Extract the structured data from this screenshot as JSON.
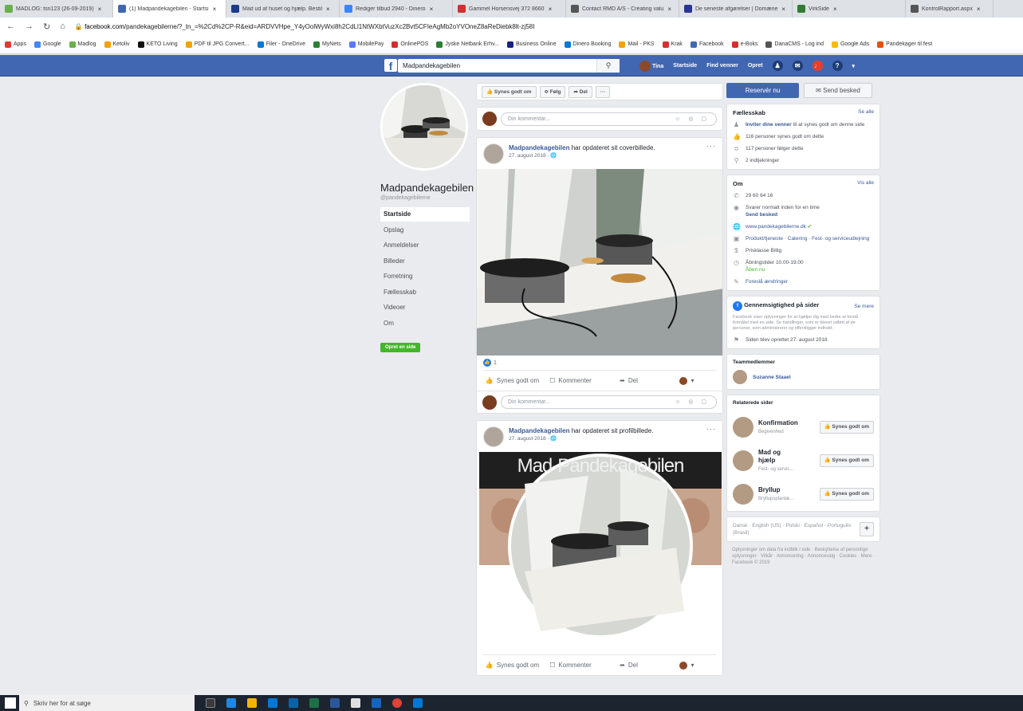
{
  "browser": {
    "tabs": [
      {
        "label": "MADLOG: tsn123 (26-09-2019)",
        "color": "#6ab04c"
      },
      {
        "label": "(1) Madpandekagebilen - Startsi",
        "color": "#4267b2",
        "active": true
      },
      {
        "label": "Mad ud af huset og hjælp. Bestil",
        "color": "#1e3a8a"
      },
      {
        "label": "Rediger tilbud 2940 - Dinero",
        "color": "#3a86ff"
      },
      {
        "label": "Gammel Horsensvej 372 8660",
        "color": "#d32f2f"
      },
      {
        "label": "Contact RMD A/S - Creating valu",
        "color": "#555555"
      },
      {
        "label": "De seneste afgørelser | Domæne",
        "color": "#283593"
      },
      {
        "label": "VirkSide",
        "color": "#2e7d32"
      },
      {
        "label": "KontrolRapport.aspx",
        "color": "#555555"
      }
    ],
    "url_prefix": "facebook.com",
    "url_rest": "/pandekagebilerne/?_tn_=%2Cd%2CP-R&eid=ARDVVHpe_Y4yOolWyWxi8h2CdLl1NtWXbtVuzXc2Bvt5CFIeAgMb2oYVOneZ8aReDiebk8lt-zj58I",
    "bookmarks": [
      {
        "label": "Apps",
        "color": "#e53935"
      },
      {
        "label": "Google",
        "color": "#4285f4"
      },
      {
        "label": "Madlog",
        "color": "#6ab04c"
      },
      {
        "label": "Ketoliv",
        "color": "#f4a300"
      },
      {
        "label": "KETO Living",
        "color": "#111111"
      },
      {
        "label": "PDF til JPG Convert...",
        "color": "#f4a300"
      },
      {
        "label": "Filer - OneDrive",
        "color": "#0078d4"
      },
      {
        "label": "MyNets",
        "color": "#2e7d32"
      },
      {
        "label": "MobilePay",
        "color": "#5a78ff"
      },
      {
        "label": "OnlinePOS",
        "color": "#d32f2f"
      },
      {
        "label": "Jyske Netbank Erhv...",
        "color": "#2e7d32"
      },
      {
        "label": "Business Online",
        "color": "#1a237e"
      },
      {
        "label": "Dinero Booking",
        "color": "#0078d4"
      },
      {
        "label": "Mail - PKS",
        "color": "#f4a300"
      },
      {
        "label": "Krak",
        "color": "#d32f2f"
      },
      {
        "label": "Facebook",
        "color": "#4267b2"
      },
      {
        "label": "e-Boks",
        "color": "#d32f2f"
      },
      {
        "label": "DanaCMS - Log ind",
        "color": "#555555"
      },
      {
        "label": "Google Ads",
        "color": "#fbbc05"
      },
      {
        "label": "Pandekager til fest",
        "color": "#e65100"
      }
    ]
  },
  "fb": {
    "search_value": "Madpandekagebilen",
    "nav": {
      "user": "Tina",
      "home": "Startside",
      "find_friends": "Find venner",
      "create": "Opret"
    }
  },
  "page": {
    "name": "Madpandekagebilen",
    "handle": "@pandekagebilerne",
    "nav": [
      "Startside",
      "Opslag",
      "Anmeldelser",
      "Billeder",
      "Forretning",
      "Fællesskab",
      "Videoer",
      "Om"
    ],
    "create_page": "Opret en side"
  },
  "actions": {
    "like": "Synes godt om",
    "follow": "Følg",
    "share": "Del",
    "more": "···"
  },
  "comment_placeholder": "Din kommentar...",
  "posts": [
    {
      "author": "Madpandekagebilen",
      "action": " har opdateret sit coverbillede.",
      "date": "27. august 2018 ·",
      "reactions": "1"
    },
    {
      "author": "Madpandekagebilen",
      "action": " har opdateret sit profilbillede.",
      "date": "27. august 2018 ·",
      "banner_text": "Mad-Pandekagebilen"
    }
  ],
  "post_actions": {
    "like": "Synes godt om",
    "comment": "Kommenter",
    "share": "Del"
  },
  "right": {
    "reserve": "Reservér nu",
    "send": "Send besked",
    "community": {
      "title": "Fællesskab",
      "see_all": "Se alle",
      "invite_link": "Inviter dine venner",
      "invite_rest": " til at synes godt om denne side",
      "likes": "116 personer synes godt om dette",
      "follows": "117 personer følger dette",
      "checkins": "2 indtjekninger"
    },
    "about": {
      "title": "Om",
      "see_all": "Vis alle",
      "phone": "29 60 64 16",
      "response": "Svarer normalt inden for en time",
      "send_message": "Send besked",
      "website": "www.pandekagebilerne.dk",
      "category": "Produkt/tjeneste · Catering · Fest- og serviceudlejning",
      "price": "Prisklasse Billig",
      "hours": "Åbningstider 10.00-19.00",
      "open_now": "Åben nu",
      "suggest": "Foreslå ændringer"
    },
    "transparency": {
      "title": "Gennemsigtighed på sider",
      "see_more": "Se mere",
      "text": "Facebook viser oplysninger for at hjælpe dig med bedre at forstå formålet med en side. Se handlinger, som er blevet udført af de personer, som administrerer og offentliggør indhold.",
      "created": "Siden blev oprettet 27. august 2018"
    },
    "team": {
      "title": "Teammedlemmer",
      "member": "Suzanne Staael"
    },
    "related": {
      "title": "Relaterede sider",
      "items": [
        {
          "name": "Konfirmation",
          "sub": "Begivenhed",
          "btn": "Synes godt om"
        },
        {
          "name": "Mad og hjælp",
          "sub": "Fest- og servic...",
          "btn": "Synes godt om"
        },
        {
          "name": "Bryllup",
          "sub": "Bryllupsplanlæ...",
          "btn": "Synes godt om"
        }
      ]
    },
    "languages": "Dansk · English (US) · Polski · Español · Português (Brasil)",
    "footer": "Oplysninger om data fra indblik i side · Beskyttelse af personlige oplysninger · Vilkår · Annoncering · Annoncevalg · Cookies · Mere · Facebook © 2019"
  },
  "taskbar": {
    "search_placeholder": "Skriv her for at søge"
  }
}
